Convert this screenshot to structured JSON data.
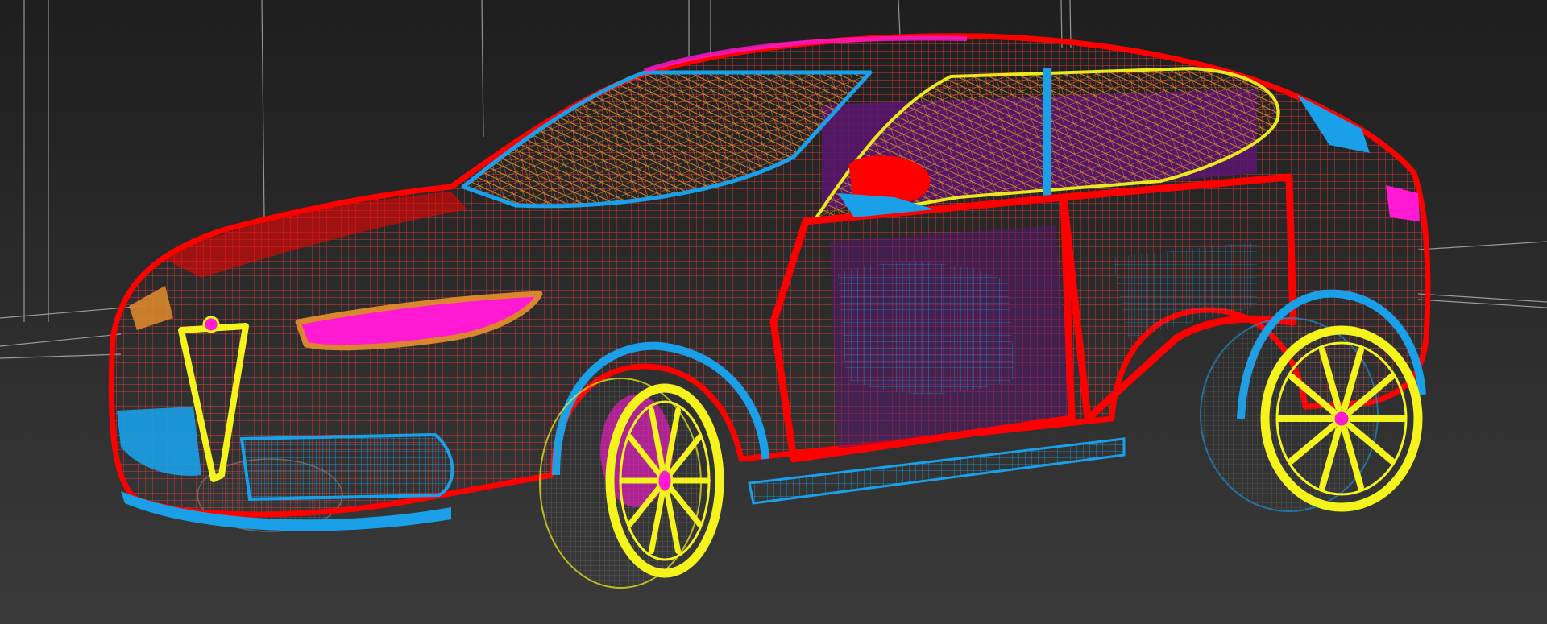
{
  "viewport": {
    "kind": "3d-viewport",
    "display_mode": "wireframe",
    "background_color": "#2a2a2a",
    "background_gradient_top": "#1e1e1e",
    "background_gradient_bottom": "#3a3a3a"
  },
  "model": {
    "subject": "hatchback-suv",
    "colors": {
      "body": "#ff0000",
      "glass": "#d9862e",
      "trim": "#1aa0e8",
      "wheels": "#f4f41c",
      "accents": "#ff19d2",
      "interior": "#5a1670",
      "helpers": "#c8c8c8"
    },
    "wheel_spokes": 10,
    "visible_wheels": 2
  }
}
